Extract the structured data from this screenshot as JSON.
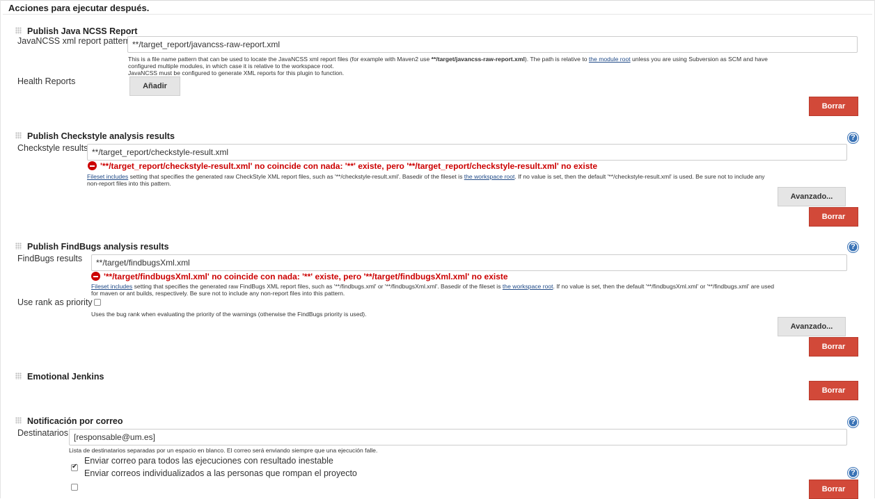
{
  "section": {
    "title": "Acciones para ejecutar después."
  },
  "ncss": {
    "title": "Publish Java NCSS Report",
    "field_label": "JavaNCSS xml report pattern",
    "value": "**/target_report/javancss-raw-report.xml",
    "help_1a": "This is a file name pattern that can be used to locate the JavaNCSS xml report files (for example with Maven2 use ",
    "help_1b": "**/target/javancss-raw-report.xml",
    "help_1c": "). The path is relative to ",
    "help_link": "the module root",
    "help_1d": " unless you are using Subversion as SCM and have",
    "help_2": "configured multiple modules, in which case it is relative to the workspace root.",
    "help_3": "JavaNCSS must be configured to generate XML reports for this plugin to function.",
    "health_label": "Health Reports",
    "add_button": "Añadir",
    "delete_button": "Borrar"
  },
  "checkstyle": {
    "title": "Publish Checkstyle analysis results",
    "field_label": "Checkstyle results",
    "value": "**/target_report/checkstyle-result.xml",
    "error": "'**/target_report/checkstyle-result.xml' no coincide con nada: '**' existe, pero '**/target_report/checkstyle-result.xml' no existe",
    "help_link1": "Fileset includes",
    "help_1a": " setting that specifies the generated raw CheckStyle XML report files, such as '**/checkstyle-result.xml'. Basedir of the fileset is ",
    "help_link2": "the workspace root",
    "help_1b": ". If no value is set, then the default '**/checkstyle-result.xml' is used. Be sure not to include any",
    "help_2": "non-report files into this pattern.",
    "advanced_button": "Avanzado...",
    "delete_button": "Borrar"
  },
  "findbugs": {
    "title": "Publish FindBugs analysis results",
    "field_label": "FindBugs results",
    "value": "**/target/findbugsXml.xml",
    "error": "'**/target/findbugsXml.xml' no coincide con nada: '**' existe, pero '**/target/findbugsXml.xml' no existe",
    "help_link1": "Fileset includes",
    "help_1a": " setting that specifies the generated raw FindBugs XML report files, such as '**/findbugs.xml' or '**/findbugsXml.xml'. Basedir of the fileset is ",
    "help_link2": "the workspace root",
    "help_1b": ". If no value is set, then the default '**/findbugsXml.xml' or '**/findbugs.xml' are used",
    "help_2": "for maven or ant builds, respectively. Be sure not to include any non-report files into this pattern.",
    "rank_label": "Use rank as priority",
    "rank_help": "Uses the bug rank when evaluating the priority of the warnings (otherwise the FindBugs priority is used).",
    "rank_checked": false,
    "advanced_button": "Avanzado...",
    "delete_button": "Borrar"
  },
  "emotional": {
    "title": "Emotional Jenkins",
    "delete_button": "Borrar"
  },
  "email": {
    "title": "Notificación por correo",
    "field_label": "Destinatarios",
    "value": "[responsable@um.es]",
    "help": "Lista de destinatarios separadas por un espacio en blanco. El correo será enviando siempre que una ejecución falle.",
    "option1": "Enviar correo para todos las ejecuciones con resultado inestable",
    "option1_checked": true,
    "option2": "Enviar correos individualizados a las personas que rompan el proyecto",
    "option2_checked": false,
    "delete_button": "Borrar"
  },
  "icons": {
    "help": "?"
  }
}
